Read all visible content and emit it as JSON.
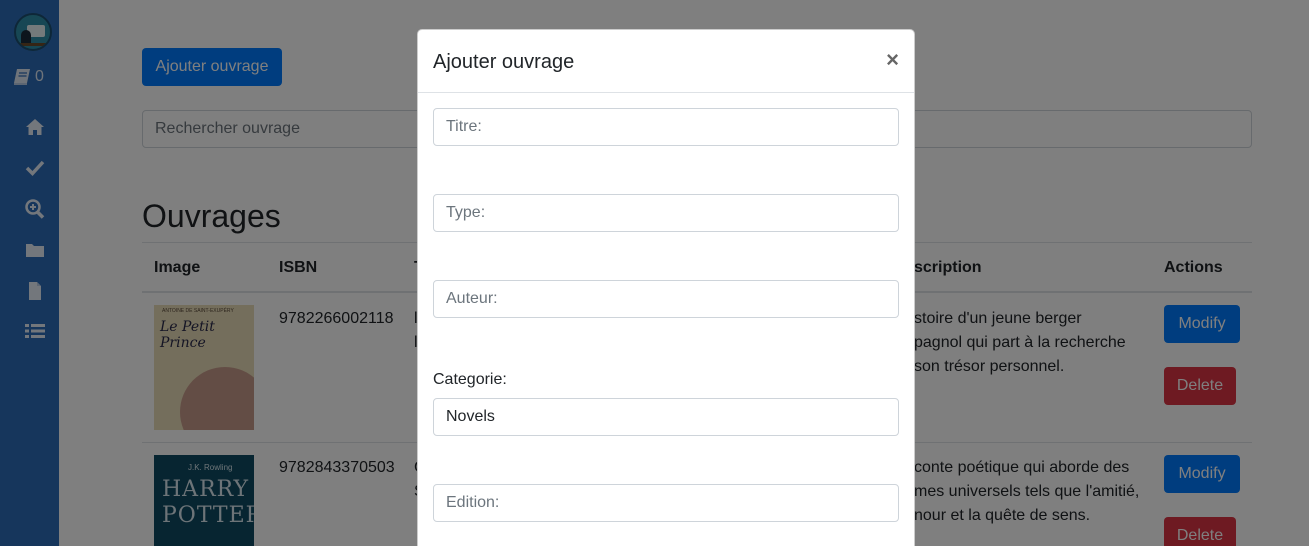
{
  "sidebar": {
    "cart_count": "0",
    "icons": [
      "home-icon",
      "check-icon",
      "search-plus-icon",
      "folder-icon",
      "file-icon",
      "list-icon"
    ]
  },
  "main": {
    "add_button": "Ajouter ouvrage",
    "search_placeholder": "Rechercher ouvrage",
    "title": "Ouvrages",
    "table": {
      "headers": [
        "Image",
        "ISBN",
        "T",
        "scription",
        "Actions"
      ],
      "rows": [
        {
          "isbn": "9782266002118",
          "title_fragment": "l\nl",
          "cover_title": "Le Petit Prince",
          "cover_author": "ANTOINE DE SAINT-EXUPÉRY",
          "description": "stoire d'un jeune berger\npagnol qui part à la recherche\nson trésor personnel.",
          "modify_label": "Modify",
          "delete_label": "Delete"
        },
        {
          "isbn": "9782843370503",
          "title_fragment": "C\nS",
          "cover_title": "HARRY\nPOTTER",
          "cover_author": "J.K. Rowling",
          "description": "conte poétique qui aborde des\nmes universels tels que l'amitié,\nnour et la quête de sens.",
          "modify_label": "Modify",
          "delete_label": "Delete"
        }
      ]
    }
  },
  "modal": {
    "title": "Ajouter ouvrage",
    "close_label": "×",
    "titre_placeholder": "Titre:",
    "type_placeholder": "Type:",
    "auteur_placeholder": "Auteur:",
    "categorie_label": "Categorie:",
    "categorie_value": "Novels",
    "edition_placeholder": "Edition:"
  },
  "colors": {
    "sidebar": "#2d6db8",
    "primary": "#007bff",
    "danger": "#dc3545"
  }
}
